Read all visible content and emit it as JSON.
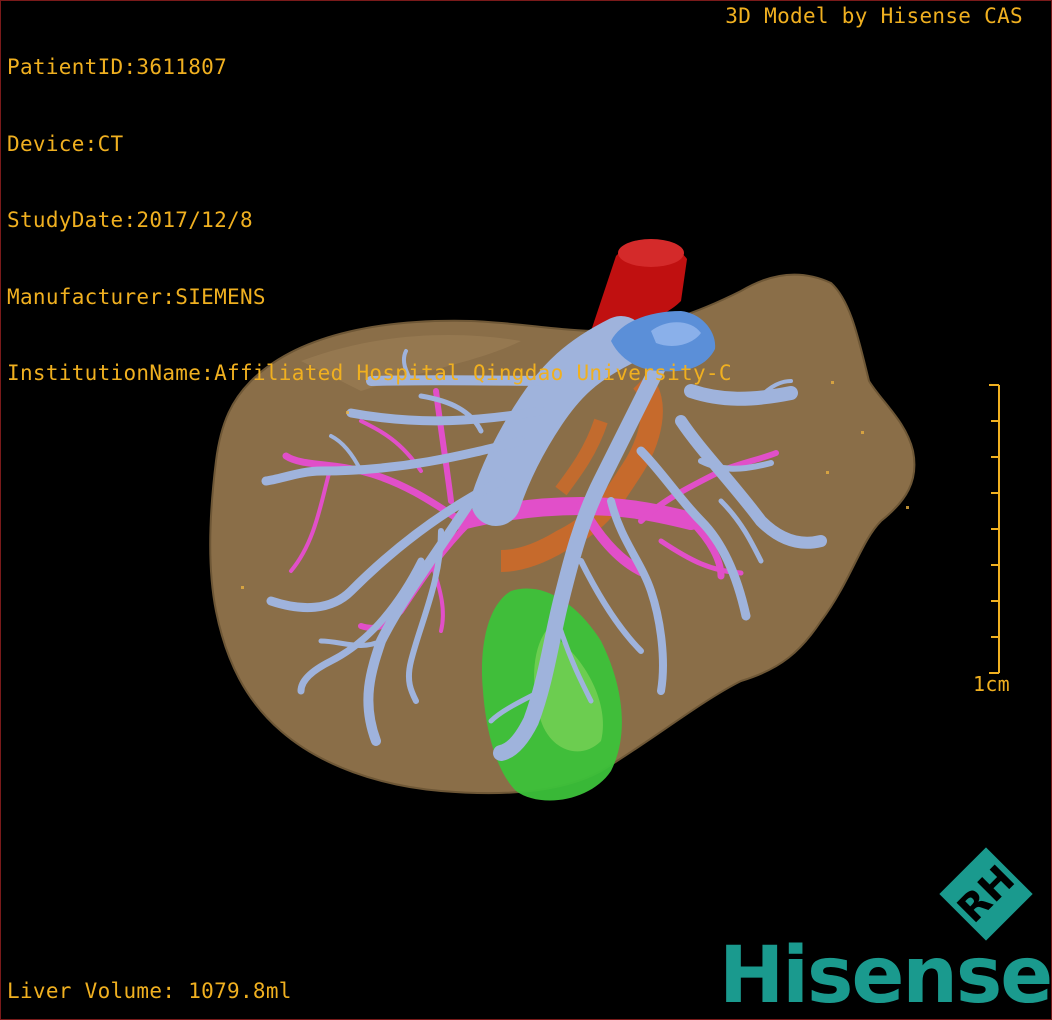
{
  "overlay": {
    "patient_id": "PatientID:3611807",
    "device": "Device:CT",
    "study_date": "StudyDate:2017/12/8",
    "manufacturer": "Manufacturer:SIEMENS",
    "institution": "InstitutionName:Affiliated Hospital Qingdao University-C",
    "model_credit": "3D Model by Hisense CAS",
    "liver_volume": "Liver Volume: 1079.8ml"
  },
  "scale_bar": {
    "label": "1cm",
    "tick_count": 9
  },
  "logo": {
    "badge_text": "RH",
    "wordmark": "Hisense"
  },
  "colors": {
    "overlay_text": "#f0b020",
    "liver": "#8a6e48",
    "hepatic_vein": "#9fb3dc",
    "portal_vein": "#e14fc9",
    "ivc": "#5b8fd8",
    "aorta": "#c01010",
    "artery": "#d06a28",
    "gallbladder": "#3cc23a",
    "brand": "#1a9a8e"
  },
  "icons": {
    "logo_badge": "hisense-rh-icon"
  }
}
